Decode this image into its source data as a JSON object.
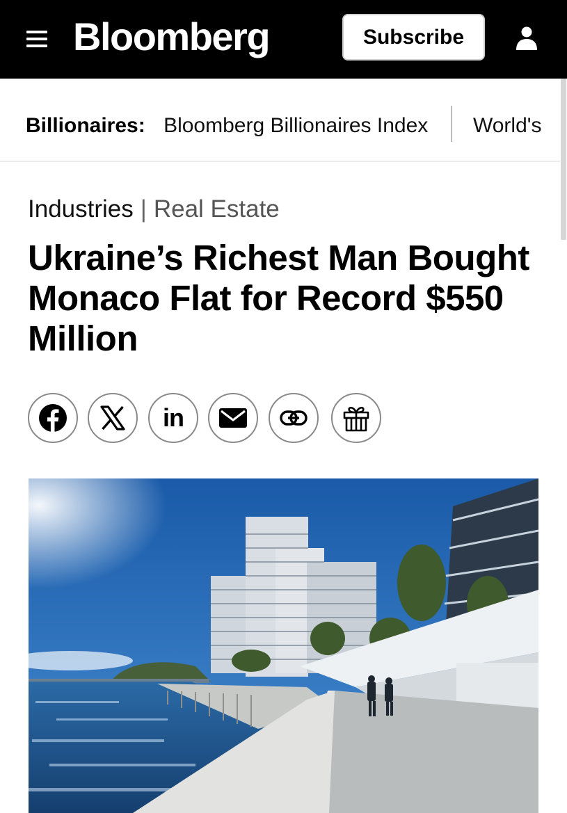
{
  "header": {
    "logo": "Bloomberg",
    "subscribe_label": "Subscribe",
    "background": "#000000",
    "icons": {
      "menu": "menu-icon",
      "user": "user-icon"
    }
  },
  "subnav": {
    "title": "Billionaires:",
    "links": [
      "Bloomberg Billionaires Index",
      "World's"
    ]
  },
  "breadcrumb": {
    "section": "Industries",
    "separator": "|",
    "subsection": "Real Estate"
  },
  "article": {
    "headline": "Ukraine’s Richest Man Bought Monaco Flat for Record $550 Million"
  },
  "share": {
    "icons": [
      "facebook-icon",
      "x-icon",
      "linkedin-icon",
      "email-icon",
      "link-icon",
      "gift-icon"
    ],
    "linkedin_text": "in"
  },
  "hero_image": {
    "subject": "waterfront-promenade-photo",
    "colors": {
      "sky": "#1f5fb0",
      "sea": "#1d4f86",
      "building": "#d9dde2"
    }
  }
}
